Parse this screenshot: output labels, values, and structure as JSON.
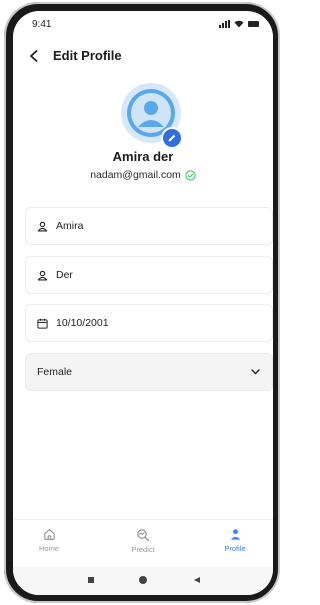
{
  "status_bar": {
    "time": "9:41"
  },
  "header": {
    "title": "Edit Profile"
  },
  "profile": {
    "name": "Amira der",
    "email": "nadam@gmail.com"
  },
  "fields": {
    "first_name": "Amira",
    "last_name": "Der",
    "birth_date": "10/10/2001",
    "gender": "Female"
  },
  "bottom_nav": {
    "items": [
      {
        "label": "Home",
        "icon": "home-icon"
      },
      {
        "label": "Predict",
        "icon": "predict-icon"
      },
      {
        "label": "Profile",
        "icon": "profile-icon",
        "active": true
      }
    ]
  },
  "colors": {
    "accent": "#3b82f6",
    "edit_badge": "#2f6fe0",
    "verified": "#22c55e",
    "avatar_bg": "#d6e7f7"
  }
}
